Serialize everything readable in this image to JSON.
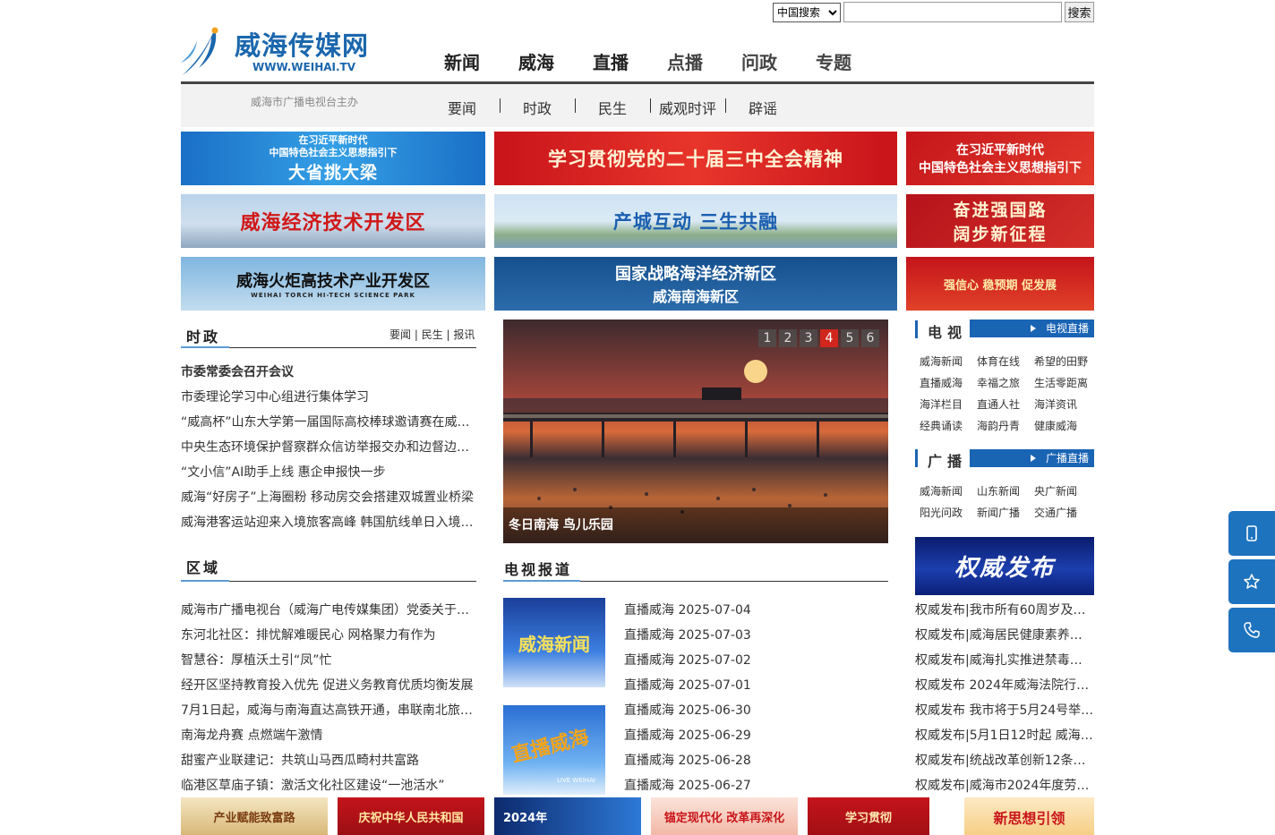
{
  "search": {
    "select_value": "中国搜索",
    "button_label": "搜索",
    "input_value": ""
  },
  "logo": {
    "name": "威海传媒网",
    "url": "WWW.WEIHAI.TV"
  },
  "nav": {
    "items": [
      "新闻",
      "威海",
      "直播",
      "点播",
      "问政",
      "专题"
    ],
    "active": "新闻"
  },
  "subnav": {
    "org_note": "威海市广播电视台主办",
    "items": [
      "要闻",
      "时政",
      "民生",
      "威观时评",
      "辟谣"
    ]
  },
  "banners": {
    "b1_line1": "在习近平新时代",
    "b1_line2": "中国特色社会主义思想指引下",
    "b1_big": "大省挑大梁",
    "b2": "学习贯彻党的二十届三中全会精神",
    "b3_line1": "在习近平新时代",
    "b3_line2": "中国特色社会主义思想指引下",
    "b4": "威海经济技术开发区",
    "b5": "产城互动  三生共融",
    "b6_line1": "奋进强国路",
    "b6_line2": "阔步新征程",
    "b7": "威海火炬高技术产业开发区",
    "b7_sub": "WEIHAI TORCH HI-TECH SCIENCE PARK",
    "b8_line1": "国家战略海洋经济新区",
    "b8_line2": "威海南海新区",
    "b9": "强信心  稳预期  促发展"
  },
  "politics": {
    "title": "时政",
    "links": [
      "要闻",
      "民生",
      "报讯"
    ],
    "items": [
      "市委常委会召开会议",
      "市委理论学习中心组进行集体学习",
      "“威高杯”山东大学第一届国际高校棒球邀请赛在威…",
      "中央生态环境保护督察群众信访举报交办和边督边…",
      "“文小信”AI助手上线 惠企申报快一步",
      "威海“好房子”上海圈粉 移动房交会搭建双城置业桥梁",
      "威海港客运站迎来入境旅客高峰 韩国航线单日入境…"
    ]
  },
  "region": {
    "title": "区域",
    "items": [
      "威海市广播电视台（威海广电传媒集团）党委关于…",
      "东河北社区：排忧解难暖民心 网格聚力有作为",
      "智慧谷：厚植沃土引“凤”忙",
      "经开区坚持教育投入优先 促进义务教育优质均衡发展",
      "7月1日起，威海与南海直达高铁开通，串联南北旅…",
      "南海龙舟赛 点燃端午激情",
      "甜蜜产业联建记：共筑山马西瓜畸村共富路",
      "临港区草庙子镇：激活文化社区建设“一池活水”"
    ]
  },
  "slider": {
    "pages": [
      "1",
      "2",
      "3",
      "4",
      "5",
      "6"
    ],
    "active_page": "4",
    "caption": "冬日南海 鸟儿乐园"
  },
  "tv_report": {
    "title": "电视报道",
    "thumb1_text": "威海新闻",
    "thumb2_text": "直播威海",
    "thumb2_badge": "LIVE WEIHAI",
    "items": [
      "直播威海 2025-07-04",
      "直播威海 2025-07-03",
      "直播威海 2025-07-02",
      "直播威海 2025-07-01",
      "直播威海 2025-06-30",
      "直播威海 2025-06-29",
      "直播威海 2025-06-28",
      "直播威海 2025-06-27"
    ]
  },
  "tv": {
    "title": "电视",
    "live_label": "电视直播",
    "programs": [
      "威海新闻",
      "体育在线",
      "希望的田野",
      "直播威海",
      "幸福之旅",
      "生活零距离",
      "海洋栏目",
      "直通人社",
      "海洋资讯",
      "经典诵读",
      "海韵丹青",
      "健康威海"
    ]
  },
  "radio": {
    "title": "广播",
    "live_label": "广播直播",
    "programs": [
      "威海新闻",
      "山东新闻",
      "央广新闻",
      "阳光问政",
      "新闻广播",
      "交通广播"
    ]
  },
  "authority": {
    "banner": "权威发布",
    "items": [
      "权威发布|我市所有60周岁及…",
      "权威发布|威海居民健康素养水…",
      "权威发布|威海扎实推进禁毒人…",
      "权威发布 2024年威海法院行…",
      "权威发布 我市将于5月24号举…",
      "权威发布|5月1日12时起 威海…",
      "权威发布|统战改革创新12条…",
      "权威发布|威海市2024年度劳…"
    ]
  },
  "bottom_tiles": [
    "产业赋能致富路",
    "庆祝中华人民共和国",
    "2024年",
    "锚定现代化 改革再深化",
    "学习贯彻",
    "新思想引领"
  ],
  "float_buttons": [
    "mobile-icon",
    "star-icon",
    "phone-icon"
  ]
}
